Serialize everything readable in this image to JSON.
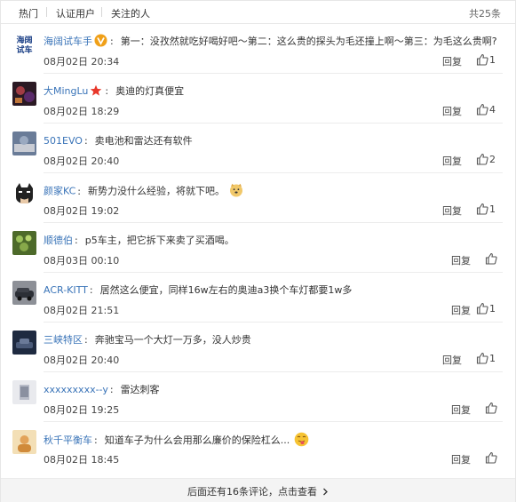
{
  "tabs": {
    "hot": "热门",
    "verified": "认证用户",
    "following": "关注的人",
    "total": "共25条"
  },
  "comments": [
    {
      "user": "海阔试车手",
      "avatar_text": "海阔\n试车",
      "text": "第一：没孜然就吃好喝好吧～第二：这么贵的探头为毛还撞上啊～第三：为毛这么贵啊?",
      "time": "08月02日 20:34",
      "reply": "回复",
      "likes": "1"
    },
    {
      "user": "大MingLu",
      "text": "奥迪的灯真便宜",
      "time": "08月02日 18:29",
      "reply": "回复",
      "likes": "4"
    },
    {
      "user": "501EVO",
      "text": "卖电池和雷达还有软件",
      "time": "08月02日 20:40",
      "reply": "回复",
      "likes": "2"
    },
    {
      "user": "颜家KC",
      "text": "新势力没什么经验，将就下吧。",
      "time": "08月02日 19:02",
      "reply": "回复",
      "likes": "1"
    },
    {
      "user": "顺德伯",
      "text": "p5车主，把它拆下来卖了买酒喝。",
      "time": "08月03日 00:10",
      "reply": "回复",
      "likes": ""
    },
    {
      "user": "ACR-KITT",
      "text": "居然这么便宜，同样16w左右的奥迪a3换个车灯都要1w多",
      "time": "08月02日 21:51",
      "reply": "回复",
      "likes": "1"
    },
    {
      "user": "三峡特区",
      "text": "奔驰宝马一个大灯一万多，没人炒贵",
      "time": "08月02日 20:40",
      "reply": "回复",
      "likes": "1"
    },
    {
      "user": "xxxxxxxxx--y",
      "text": "雷达刺客",
      "time": "08月02日 19:25",
      "reply": "回复",
      "likes": ""
    },
    {
      "user": "秋千平衡车",
      "text": "知道车子为什么会用那么廉价的保险杠么...",
      "time": "08月02日 18:45",
      "reply": "回复",
      "likes": ""
    }
  ],
  "footer": {
    "more": "后面还有16条评论，点击查看"
  },
  "colors": {
    "link": "#3a74b8",
    "badge_vip": "#f0a018",
    "badge_star": "#e8372a"
  }
}
